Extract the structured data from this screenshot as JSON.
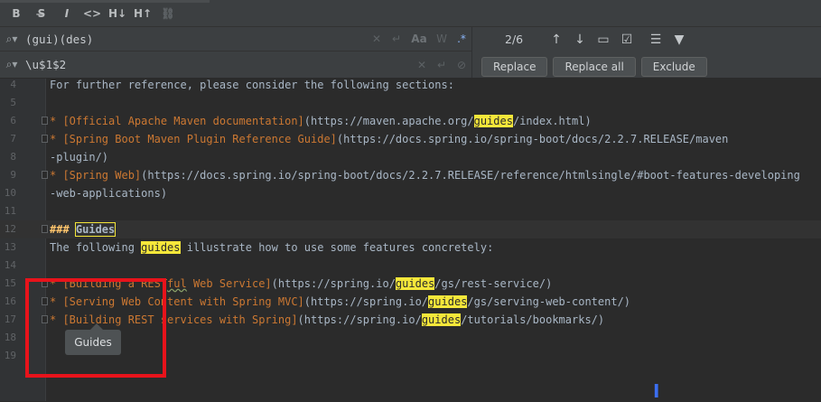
{
  "toolbar": {
    "items": [
      {
        "name": "bold-button",
        "glyph": "B"
      },
      {
        "name": "strikethrough-button",
        "glyph": "S̶"
      },
      {
        "name": "italic-button",
        "glyph": "I"
      },
      {
        "name": "code-button",
        "glyph": "<>"
      },
      {
        "name": "heading-decrease-button",
        "glyph": "H↓"
      },
      {
        "name": "heading-increase-button",
        "glyph": "H↑"
      },
      {
        "name": "link-button",
        "glyph": "⛓"
      }
    ]
  },
  "find": {
    "search_value": "(gui)(des)",
    "replace_value": "\\u$1$2",
    "match_count": "2/6",
    "replace_label": "Replace",
    "replace_all_label": "Replace all",
    "exclude_label": "Exclude"
  },
  "tooltip": {
    "text": "Guides"
  },
  "editor": {
    "lines": [
      {
        "n": "4",
        "text": "For further reference, please consider the following sections:"
      },
      {
        "n": "5",
        "text": ""
      },
      {
        "n": "6",
        "text": "* [Official Apache Maven documentation](https://maven.apache.org/guides/index.html)"
      },
      {
        "n": "7",
        "text": "* [Spring Boot Maven Plugin Reference Guide](https://docs.spring.io/spring-boot/docs/2.2.7.RELEASE/maven"
      },
      {
        "n": "8",
        "text": "-plugin/)"
      },
      {
        "n": "9",
        "text": "* [Spring Web](https://docs.spring.io/spring-boot/docs/2.2.7.RELEASE/reference/htmlsingle/#boot-features-developing"
      },
      {
        "n": "10",
        "text": "-web-applications)"
      },
      {
        "n": "11",
        "text": ""
      },
      {
        "n": "12",
        "text": "### Guides"
      },
      {
        "n": "13",
        "text": "The following guides illustrate how to use some features concretely:"
      },
      {
        "n": "14",
        "text": ""
      },
      {
        "n": "15",
        "text": "* [Building a RESTful Web Service](https://spring.io/guides/gs/rest-service/)"
      },
      {
        "n": "16",
        "text": "* [Serving Web Content with Spring MVC](https://spring.io/guides/gs/serving-web-content/)"
      },
      {
        "n": "17",
        "text": "* [Building REST services with Spring](https://spring.io/guides/tutorials/bookmarks/)"
      },
      {
        "n": "18",
        "text": ""
      },
      {
        "n": "19",
        "text": ""
      }
    ]
  },
  "colors": {
    "match_highlight": "#f5e73a",
    "annotation_box": "#e8131b",
    "link_text": "#cc7832"
  }
}
